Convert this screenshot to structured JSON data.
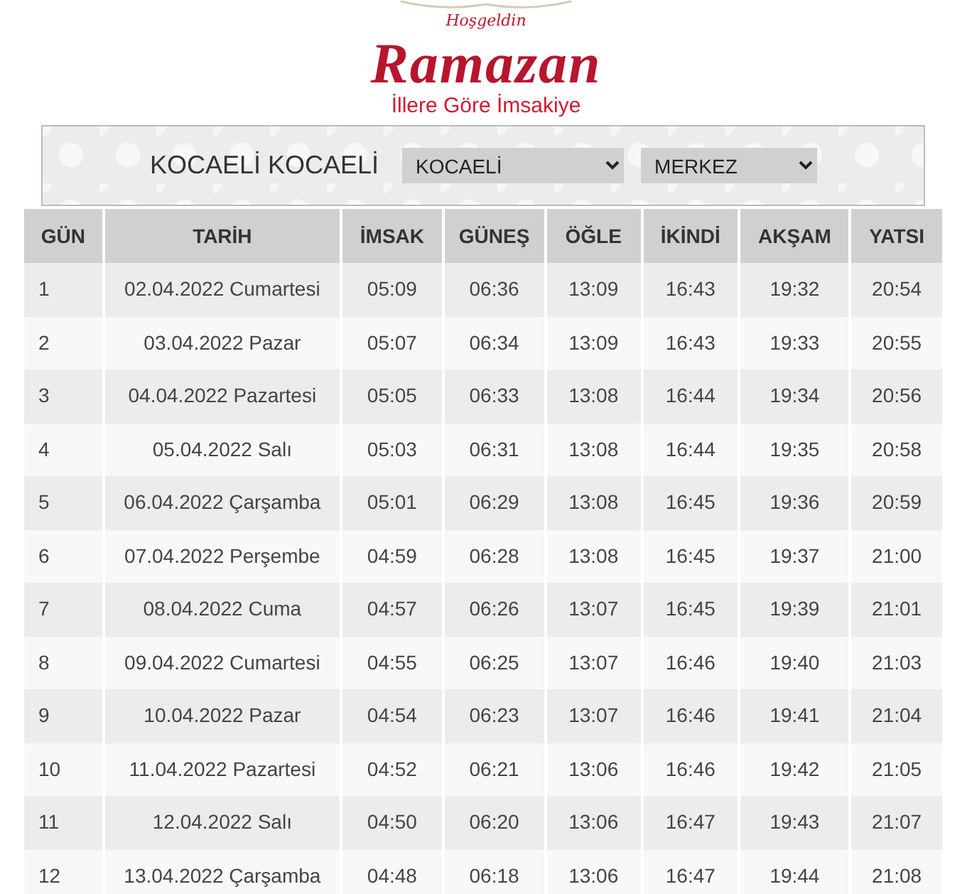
{
  "header": {
    "greeting": "Hoşgeldin",
    "title": "Ramazan",
    "subtitle": "İllere Göre İmsakiye"
  },
  "location": {
    "label": "KOCAELİ KOCAELİ",
    "city": "KOCAELİ",
    "district": "MERKEZ"
  },
  "table": {
    "columns": [
      "GÜN",
      "TARİH",
      "İMSAK",
      "GÜNEŞ",
      "ÖĞLE",
      "İKİNDİ",
      "AKŞAM",
      "YATSI"
    ],
    "rows": [
      [
        "1",
        "02.04.2022 Cumartesi",
        "05:09",
        "06:36",
        "13:09",
        "16:43",
        "19:32",
        "20:54"
      ],
      [
        "2",
        "03.04.2022 Pazar",
        "05:07",
        "06:34",
        "13:09",
        "16:43",
        "19:33",
        "20:55"
      ],
      [
        "3",
        "04.04.2022 Pazartesi",
        "05:05",
        "06:33",
        "13:08",
        "16:44",
        "19:34",
        "20:56"
      ],
      [
        "4",
        "05.04.2022 Salı",
        "05:03",
        "06:31",
        "13:08",
        "16:44",
        "19:35",
        "20:58"
      ],
      [
        "5",
        "06.04.2022 Çarşamba",
        "05:01",
        "06:29",
        "13:08",
        "16:45",
        "19:36",
        "20:59"
      ],
      [
        "6",
        "07.04.2022 Perşembe",
        "04:59",
        "06:28",
        "13:08",
        "16:45",
        "19:37",
        "21:00"
      ],
      [
        "7",
        "08.04.2022 Cuma",
        "04:57",
        "06:26",
        "13:07",
        "16:45",
        "19:39",
        "21:01"
      ],
      [
        "8",
        "09.04.2022 Cumartesi",
        "04:55",
        "06:25",
        "13:07",
        "16:46",
        "19:40",
        "21:03"
      ],
      [
        "9",
        "10.04.2022 Pazar",
        "04:54",
        "06:23",
        "13:07",
        "16:46",
        "19:41",
        "21:04"
      ],
      [
        "10",
        "11.04.2022 Pazartesi",
        "04:52",
        "06:21",
        "13:06",
        "16:46",
        "19:42",
        "21:05"
      ],
      [
        "11",
        "12.04.2022 Salı",
        "04:50",
        "06:20",
        "13:06",
        "16:47",
        "19:43",
        "21:07"
      ],
      [
        "12",
        "13.04.2022 Çarşamba",
        "04:48",
        "06:18",
        "13:06",
        "16:47",
        "19:44",
        "21:08"
      ]
    ]
  }
}
